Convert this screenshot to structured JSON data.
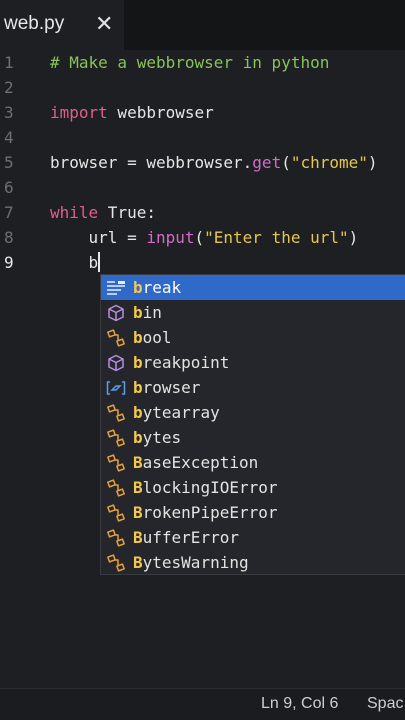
{
  "tab": {
    "filename": "web.py",
    "close_glyph": "✕"
  },
  "editor": {
    "line_numbers": [
      "1",
      "2",
      "3",
      "4",
      "5",
      "6",
      "7",
      "8",
      "9"
    ],
    "lines": [
      {
        "comment": "# Make a webbrowser in python"
      },
      {},
      {
        "keyword": "import",
        "rest": " webbrowser"
      },
      {},
      {
        "pre": "browser = webbrowser.",
        "fn": "get",
        "open": "(",
        "str": "\"chrome\"",
        "close": ")"
      },
      {},
      {
        "keyword": "while",
        "rest": " True:"
      },
      {
        "indent": "    url = ",
        "fn": "input",
        "open": "(",
        "str": "\"Enter the url\"",
        "close": ")"
      },
      {
        "indent": "    b"
      }
    ]
  },
  "autocomplete": {
    "typed_prefix": "b",
    "items": [
      {
        "first": "b",
        "rest": "reak",
        "icon": "keyword-icon",
        "selected": true
      },
      {
        "first": "b",
        "rest": "in",
        "icon": "cube-icon"
      },
      {
        "first": "b",
        "rest": "ool",
        "icon": "class-icon"
      },
      {
        "first": "b",
        "rest": "reakpoint",
        "icon": "cube-icon"
      },
      {
        "first": "b",
        "rest": "rowser",
        "icon": "variable-icon"
      },
      {
        "first": "b",
        "rest": "ytearray",
        "icon": "class-icon"
      },
      {
        "first": "b",
        "rest": "ytes",
        "icon": "class-icon"
      },
      {
        "first": "B",
        "rest": "aseException",
        "icon": "class-icon"
      },
      {
        "first": "B",
        "rest": "lockingIOError",
        "icon": "class-icon"
      },
      {
        "first": "B",
        "rest": "rokenPipeError",
        "icon": "class-icon"
      },
      {
        "first": "B",
        "rest": "ufferError",
        "icon": "class-icon"
      },
      {
        "first": "B",
        "rest": "ytesWarning",
        "icon": "class-icon"
      }
    ]
  },
  "status": {
    "position": "Ln 9, Col 6",
    "indent": "Spac"
  }
}
